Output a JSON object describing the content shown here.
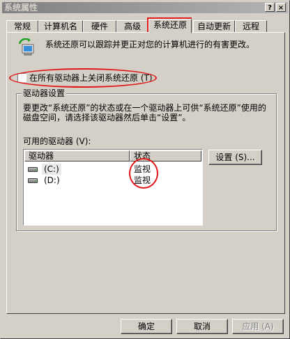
{
  "window": {
    "title": "系统属性",
    "help_glyph": "?",
    "close_glyph": "×"
  },
  "tabs": [
    {
      "label": "常规"
    },
    {
      "label": "计算机名"
    },
    {
      "label": "硬件"
    },
    {
      "label": "高级"
    },
    {
      "label": "系统还原",
      "active": true
    },
    {
      "label": "自动更新"
    },
    {
      "label": "远程"
    }
  ],
  "header": {
    "description": "系统还原可以跟踪并更正对您的计算机进行的有害更改。",
    "icon": "system-restore-icon"
  },
  "disable_checkbox": {
    "label": "在所有驱动器上关闭系统还原 (T)",
    "checked": false
  },
  "drive_settings": {
    "group_title": "驱动器设置",
    "description": "要更改“系统还原”的状态或在一个驱动器上可供“系统还原”使用的磁盘空间，请选择该驱动器然后单击“设置”。",
    "available_label": "可用的驱动器 (V):",
    "columns": {
      "drive": "驱动器",
      "status": "状态"
    },
    "drives": [
      {
        "name": "(C:)",
        "status": "监视",
        "selected": true
      },
      {
        "name": "(D:)",
        "status": "监视",
        "selected": false
      }
    ],
    "settings_button": "设置 (S)..."
  },
  "footer": {
    "ok": "确定",
    "cancel": "取消",
    "apply": "应用 (A)"
  },
  "colors": {
    "annotation_red": "#e01818",
    "dialog_gray": "#d4d0c8"
  }
}
